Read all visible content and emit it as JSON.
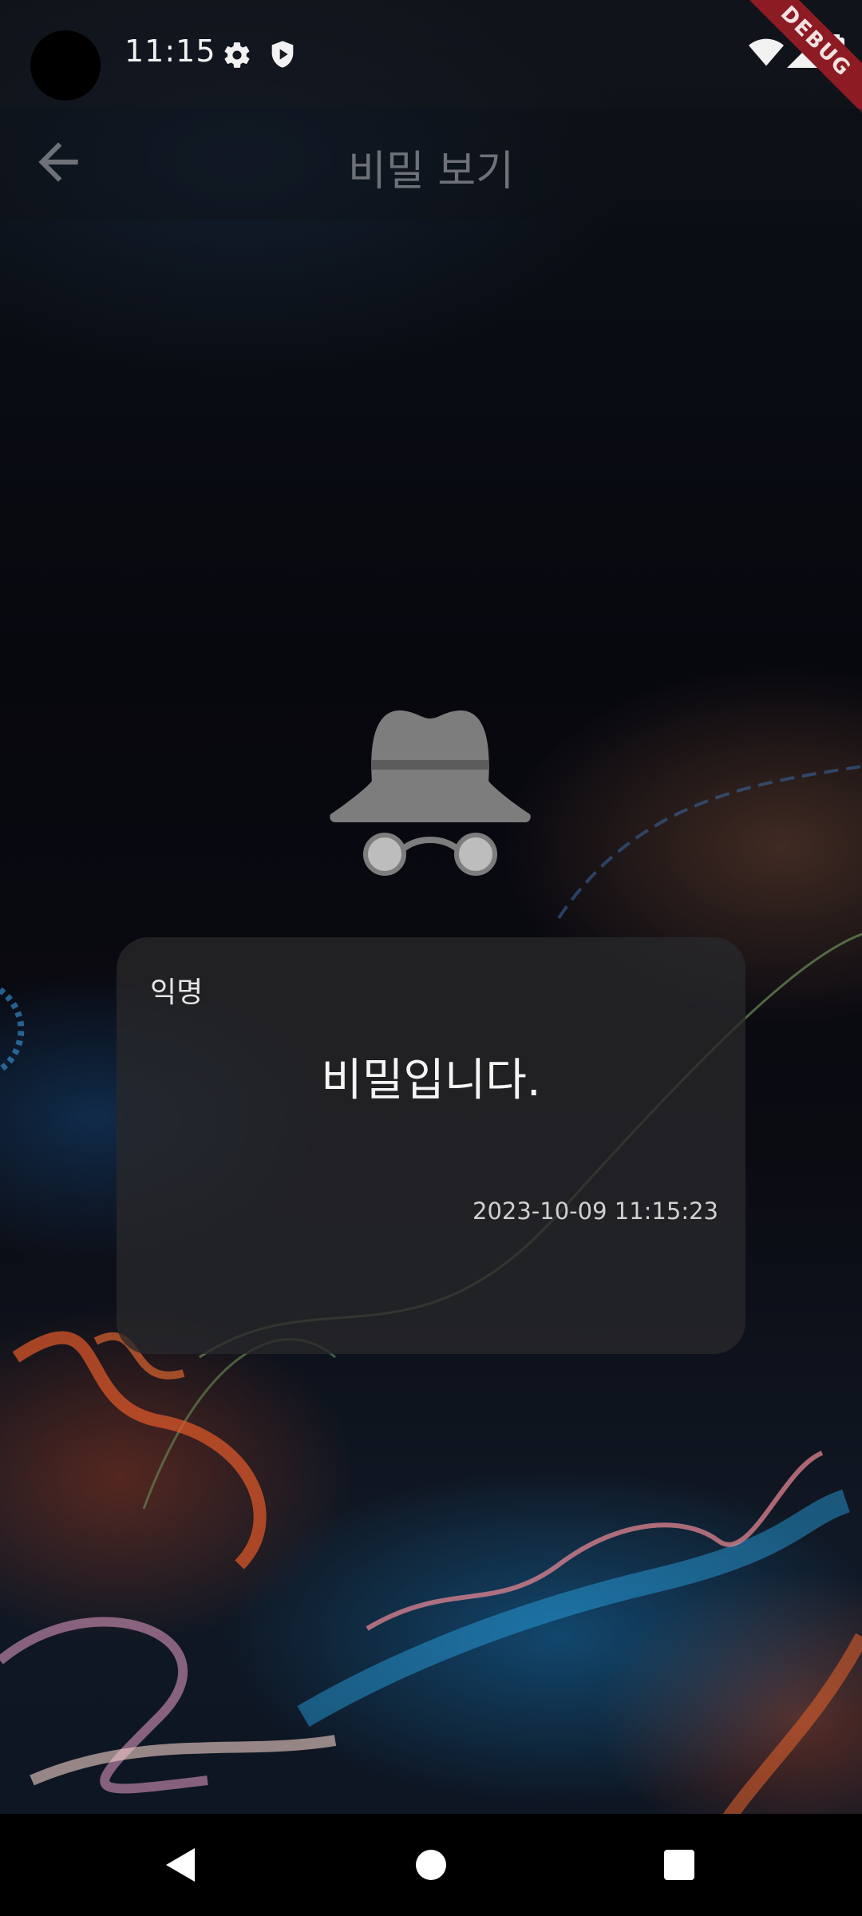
{
  "status_bar": {
    "time": "11:15",
    "icons": [
      "settings-icon",
      "shield-play-icon",
      "wifi-icon",
      "cellular-signal-icon",
      "battery-icon"
    ],
    "debug_banner": "DEBUG"
  },
  "app_bar": {
    "back_icon": "arrow-back-icon",
    "title": "비밀 보기"
  },
  "secret_card": {
    "author": "익명",
    "content": "비밀입니다.",
    "timestamp": "2023-10-09 11:15:23"
  },
  "hero_icon": "incognito-icon",
  "nav_bar": {
    "buttons": [
      "back-triangle-icon",
      "home-circle-icon",
      "recents-square-icon"
    ]
  },
  "colors": {
    "card_bg": "#28282a",
    "title_text": "#6f7179",
    "debug_banner": "#8d1b24"
  }
}
